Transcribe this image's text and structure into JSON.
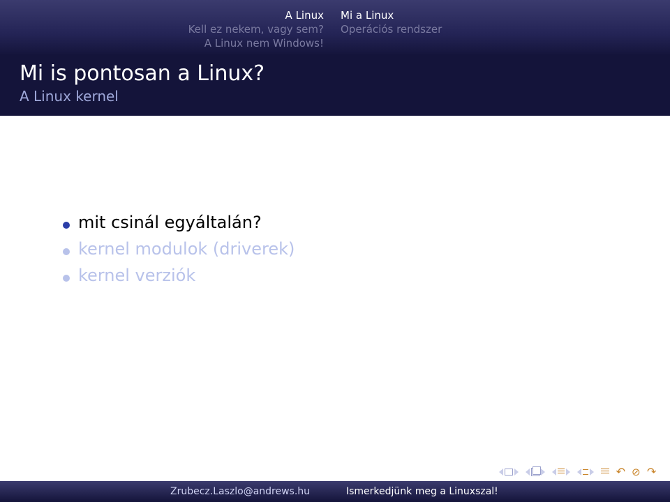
{
  "header": {
    "left": {
      "section_active": "A Linux",
      "section_dim_1": "Kell ez nekem, vagy sem?",
      "section_dim_2": "A Linux nem Windows!"
    },
    "right": {
      "sub_active": "Mi a Linux",
      "sub_dim": "Operációs rendszer"
    }
  },
  "title": {
    "main": "Mi is pontosan a Linux?",
    "sub": "A Linux kernel"
  },
  "bullets": [
    {
      "text": "mit csinál egyáltalán?",
      "revealed": true
    },
    {
      "text": "kernel modulok (driverek)",
      "revealed": false
    },
    {
      "text": "kernel verziók",
      "revealed": false
    }
  ],
  "footer": {
    "author": "Zrubecz.Laszlo@andrews.hu",
    "short_title": "Ismerkedjünk meg a Linuxszal!"
  },
  "icons": {
    "nav_prev_slide": "prev-slide",
    "nav_next_slide": "next-slide",
    "nav_prev_frame": "prev-frame",
    "nav_next_frame": "next-frame",
    "nav_prev_sub": "prev-subsection",
    "nav_next_sub": "next-subsection",
    "nav_prev_sec": "prev-section",
    "nav_next_sec": "next-section",
    "undo": "go-back",
    "search": "search"
  }
}
